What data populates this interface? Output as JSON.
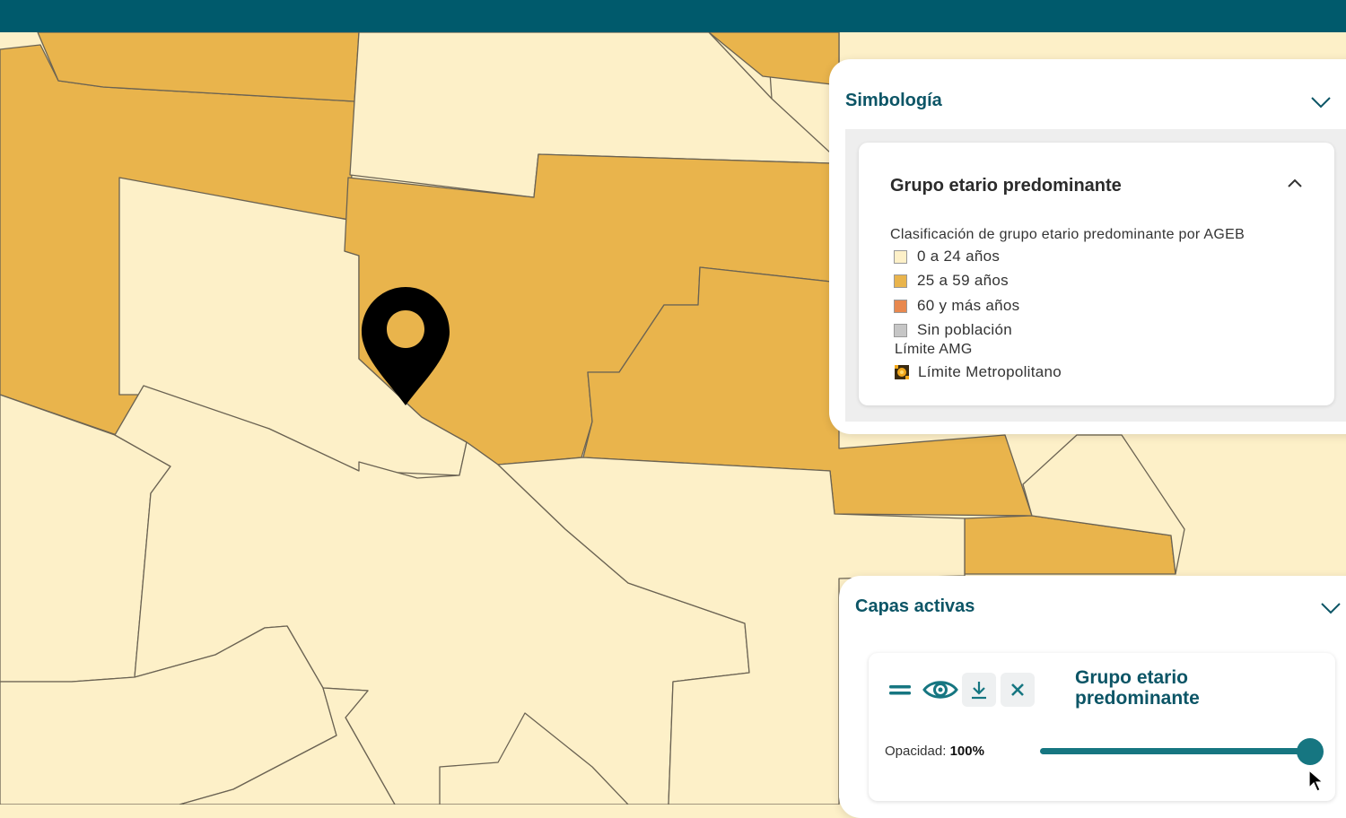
{
  "colors": {
    "header": "#005a6c",
    "young": "#fdf0c8",
    "adult": "#e9b44c",
    "senior": "#e8884e",
    "no_population": "#c6c6c6",
    "accent": "#167681",
    "title": "#0c5566"
  },
  "map": {
    "marker_icon": "location-pin-icon"
  },
  "symbology": {
    "title": "Simbología",
    "collapse_icon": "chevron-down-icon",
    "layer": {
      "title": "Grupo etario predominante",
      "toggle_icon": "chevron-up-icon",
      "description": "Clasificación de grupo etario predominante por AGEB",
      "items": [
        {
          "label": "0 a 24 años",
          "color": "#fdf0c8"
        },
        {
          "label": "25 a 59 años",
          "color": "#e9b44c"
        },
        {
          "label": "60 y más años",
          "color": "#e8884e"
        },
        {
          "label": "Sin población",
          "color": "#c6c6c6"
        }
      ],
      "subheading": "Límite AMG",
      "boundary": {
        "label": "Límite Metropolitano",
        "icon": "metropolitan-boundary-icon"
      }
    }
  },
  "active_layers": {
    "title": "Capas activas",
    "collapse_icon": "chevron-down-icon",
    "layer": {
      "name": "Grupo etario predominante",
      "tools": [
        "drag-handle-icon",
        "eye-icon",
        "download-icon",
        "close-icon"
      ],
      "opacity_label": "Opacidad:",
      "opacity_value": "100%",
      "opacity_fraction": 1.0
    }
  }
}
